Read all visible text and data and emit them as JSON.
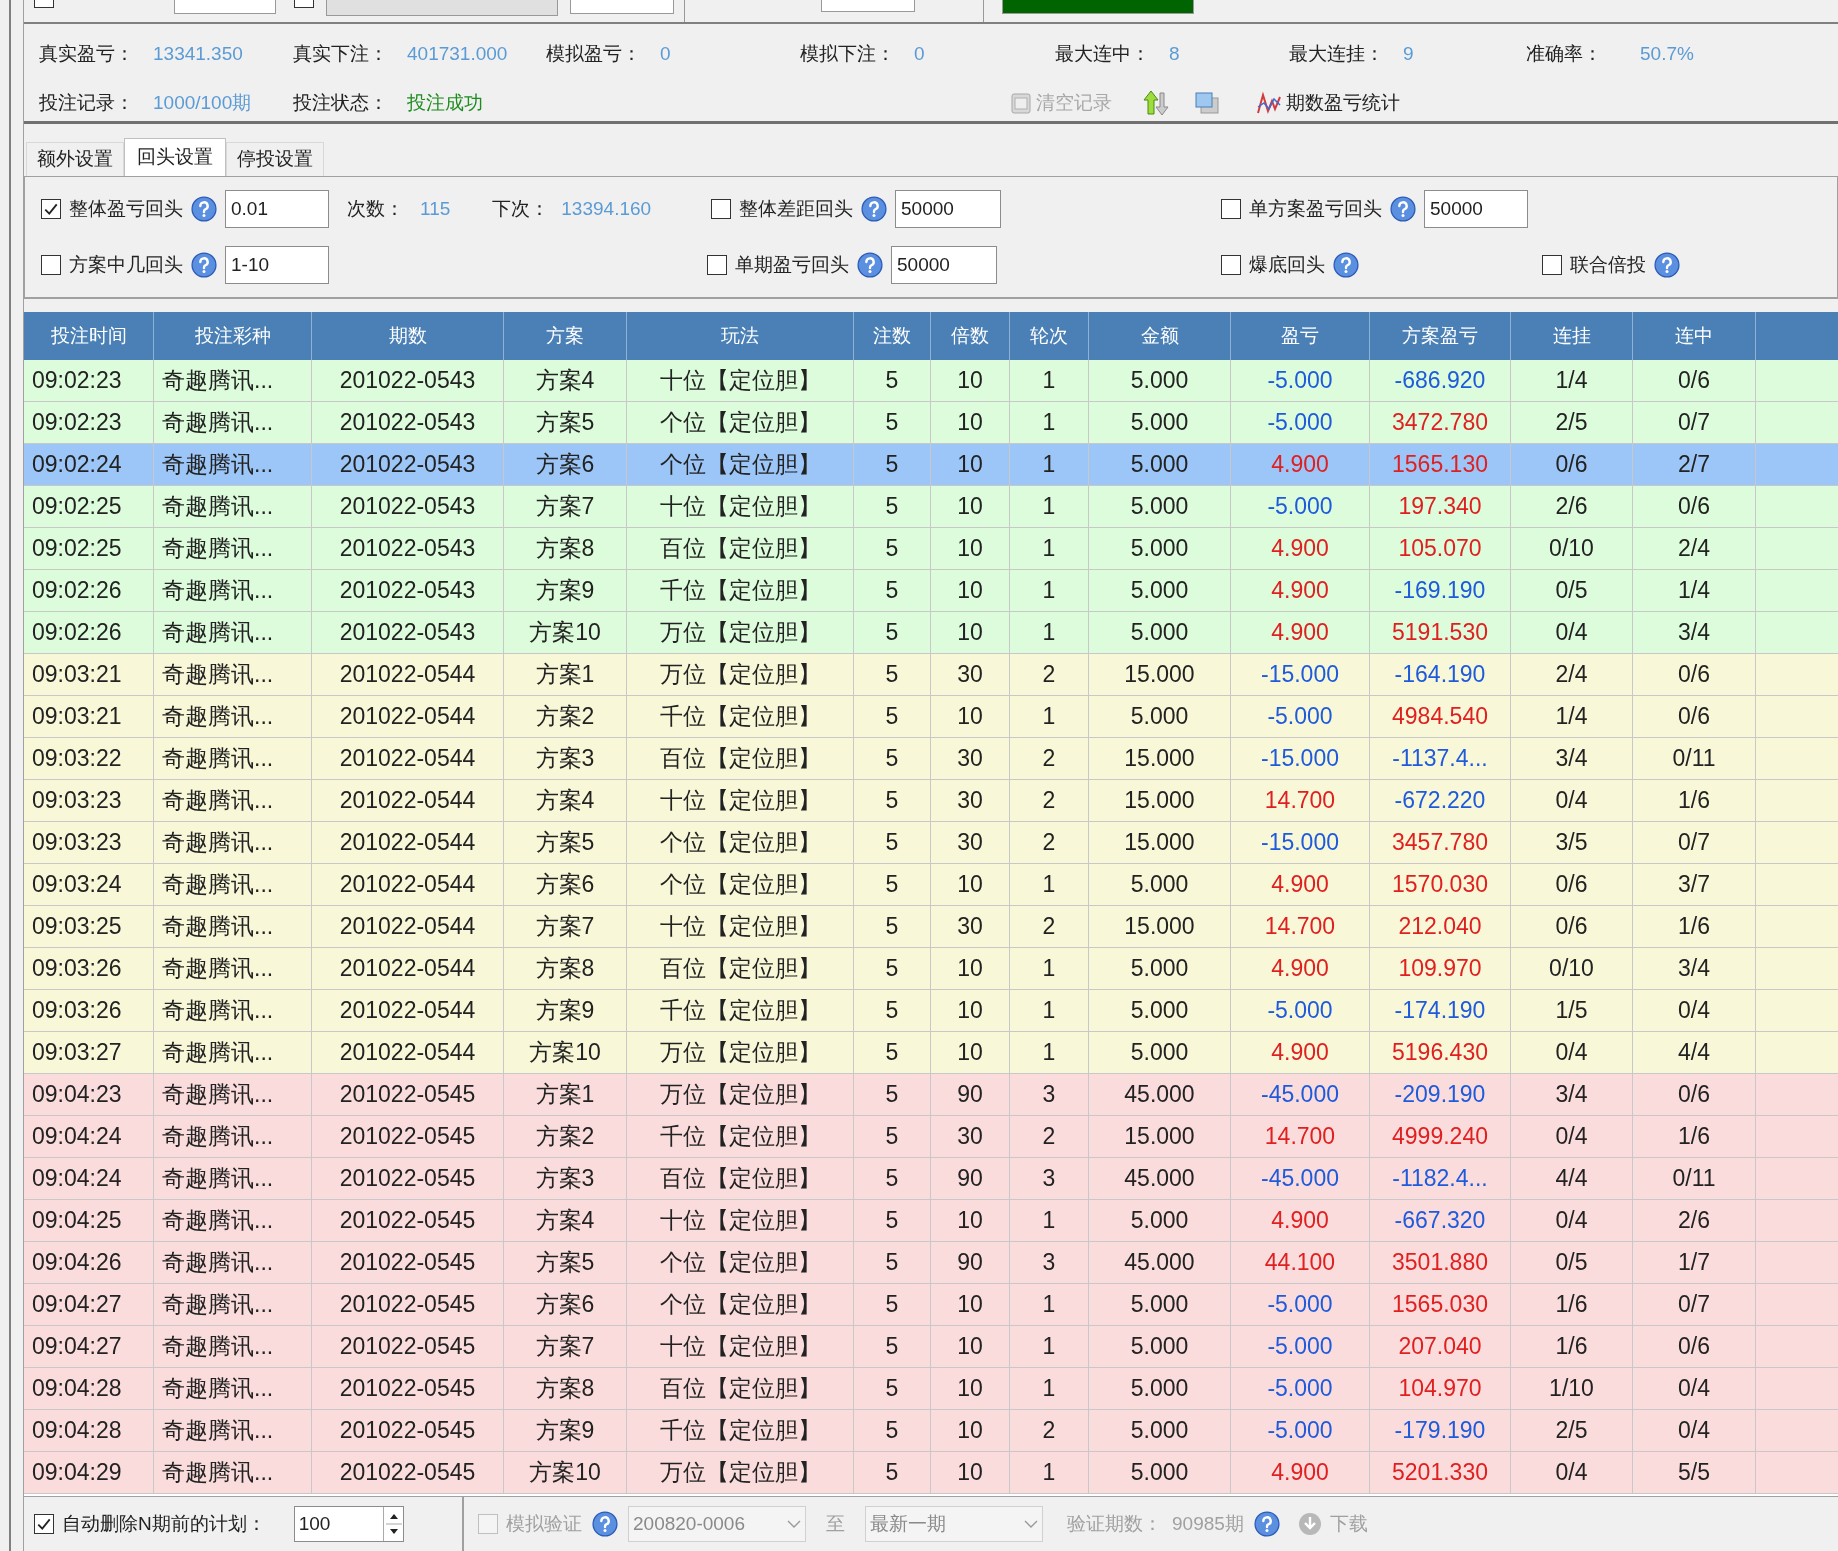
{
  "top": {
    "checkboxes": [
      {
        "checked": false
      },
      {
        "checked": false
      }
    ],
    "progress": {
      "level": 1
    }
  },
  "stats": [
    {
      "label": "真实盈亏：",
      "value": "13341.350"
    },
    {
      "label": "真实下注：",
      "value": "401731.000"
    },
    {
      "label": "模拟盈亏：",
      "value": "0"
    },
    {
      "label": "模拟下注：",
      "value": "0"
    },
    {
      "label": "最大连中：",
      "value": "8"
    },
    {
      "label": "最大连挂：",
      "value": "9"
    },
    {
      "label": "准确率：",
      "value": "50.7%"
    }
  ],
  "record": {
    "label": "投注记录：",
    "value": "1000/100期"
  },
  "status": {
    "label": "投注状态：",
    "value": "投注成功"
  },
  "toolbar": [
    {
      "kind": "clear",
      "label": "清空记录",
      "disabled": true
    },
    {
      "kind": "sort"
    },
    {
      "kind": "window"
    },
    {
      "kind": "stats",
      "label": "期数盈亏统计",
      "disabled": false
    }
  ],
  "tabs": [
    {
      "label": "额外设置",
      "selected": false
    },
    {
      "label": "回头设置",
      "selected": true
    },
    {
      "label": "停投设置",
      "selected": false
    }
  ],
  "settings": {
    "overall": {
      "label": "整体盈亏回头",
      "checked": true,
      "value": "0.01"
    },
    "count": {
      "label": "次数：",
      "value": "115"
    },
    "next": {
      "label": "下次：",
      "value": "13394.160"
    },
    "gap": {
      "label": "整体差距回头",
      "checked": false,
      "value": "50000"
    },
    "single_plan": {
      "label": "单方案盈亏回头",
      "checked": false,
      "value": "50000"
    },
    "plan_hit": {
      "label": "方案中几回头",
      "checked": false,
      "value": "1-10"
    },
    "single_period": {
      "label": "单期盈亏回头",
      "checked": false,
      "value": "50000"
    },
    "bottom_out": {
      "label": "爆底回头",
      "checked": false
    },
    "joint": {
      "label": "联合倍投",
      "checked": false
    }
  },
  "table": {
    "columns": [
      "投注时间",
      "投注彩种",
      "期数",
      "方案",
      "玩法",
      "注数",
      "倍数",
      "轮次",
      "金额",
      "盈亏",
      "方案盈亏",
      "连挂",
      "连中"
    ],
    "rows": [
      {
        "cells": [
          "09:02:23",
          "奇趣腾讯...",
          "201022-0543",
          "方案4",
          "十位【定位胆】",
          "5",
          "10",
          "1",
          "5.000",
          "-5.000",
          "-686.920",
          "1/4",
          "0/6"
        ],
        "color": "#dcfcdc",
        "selected": false,
        "loss": true,
        "plan_loss": true
      },
      {
        "cells": [
          "09:02:23",
          "奇趣腾讯...",
          "201022-0543",
          "方案5",
          "个位【定位胆】",
          "5",
          "10",
          "1",
          "5.000",
          "-5.000",
          "3472.780",
          "2/5",
          "0/7"
        ],
        "color": "#dcfcdc",
        "selected": false,
        "loss": true,
        "plan_loss": false
      },
      {
        "cells": [
          "09:02:24",
          "奇趣腾讯...",
          "201022-0543",
          "方案6",
          "个位【定位胆】",
          "5",
          "10",
          "1",
          "5.000",
          "4.900",
          "1565.130",
          "0/6",
          "2/7"
        ],
        "selected": true,
        "loss": false,
        "plan_loss": false
      },
      {
        "cells": [
          "09:02:25",
          "奇趣腾讯...",
          "201022-0543",
          "方案7",
          "十位【定位胆】",
          "5",
          "10",
          "1",
          "5.000",
          "-5.000",
          "197.340",
          "2/6",
          "0/6"
        ],
        "color": "#dcfcdc",
        "selected": false,
        "loss": true,
        "plan_loss": false
      },
      {
        "cells": [
          "09:02:25",
          "奇趣腾讯...",
          "201022-0543",
          "方案8",
          "百位【定位胆】",
          "5",
          "10",
          "1",
          "5.000",
          "4.900",
          "105.070",
          "0/10",
          "2/4"
        ],
        "color": "#dcfcdc",
        "selected": false,
        "loss": false,
        "plan_loss": false
      },
      {
        "cells": [
          "09:02:26",
          "奇趣腾讯...",
          "201022-0543",
          "方案9",
          "千位【定位胆】",
          "5",
          "10",
          "1",
          "5.000",
          "4.900",
          "-169.190",
          "0/5",
          "1/4"
        ],
        "color": "#dcfcdc",
        "selected": false,
        "loss": false,
        "plan_loss": true
      },
      {
        "cells": [
          "09:02:26",
          "奇趣腾讯...",
          "201022-0543",
          "方案10",
          "万位【定位胆】",
          "5",
          "10",
          "1",
          "5.000",
          "4.900",
          "5191.530",
          "0/4",
          "3/4"
        ],
        "color": "#dcfcdc",
        "selected": false,
        "loss": false,
        "plan_loss": false
      },
      {
        "cells": [
          "09:03:21",
          "奇趣腾讯...",
          "201022-0544",
          "方案1",
          "万位【定位胆】",
          "5",
          "30",
          "2",
          "15.000",
          "-15.000",
          "-164.190",
          "2/4",
          "0/6"
        ],
        "color": "#f8f8d8",
        "selected": false,
        "loss": true,
        "plan_loss": true
      },
      {
        "cells": [
          "09:03:21",
          "奇趣腾讯...",
          "201022-0544",
          "方案2",
          "千位【定位胆】",
          "5",
          "10",
          "1",
          "5.000",
          "-5.000",
          "4984.540",
          "1/4",
          "0/6"
        ],
        "color": "#f8f8d8",
        "selected": false,
        "loss": true,
        "plan_loss": false
      },
      {
        "cells": [
          "09:03:22",
          "奇趣腾讯...",
          "201022-0544",
          "方案3",
          "百位【定位胆】",
          "5",
          "30",
          "2",
          "15.000",
          "-15.000",
          "-1137.4...",
          "3/4",
          "0/11"
        ],
        "color": "#f8f8d8",
        "selected": false,
        "loss": true,
        "plan_loss": true
      },
      {
        "cells": [
          "09:03:23",
          "奇趣腾讯...",
          "201022-0544",
          "方案4",
          "十位【定位胆】",
          "5",
          "30",
          "2",
          "15.000",
          "14.700",
          "-672.220",
          "0/4",
          "1/6"
        ],
        "color": "#f8f8d8",
        "selected": false,
        "loss": false,
        "plan_loss": true
      },
      {
        "cells": [
          "09:03:23",
          "奇趣腾讯...",
          "201022-0544",
          "方案5",
          "个位【定位胆】",
          "5",
          "30",
          "2",
          "15.000",
          "-15.000",
          "3457.780",
          "3/5",
          "0/7"
        ],
        "color": "#f8f8d8",
        "selected": false,
        "loss": true,
        "plan_loss": false
      },
      {
        "cells": [
          "09:03:24",
          "奇趣腾讯...",
          "201022-0544",
          "方案6",
          "个位【定位胆】",
          "5",
          "10",
          "1",
          "5.000",
          "4.900",
          "1570.030",
          "0/6",
          "3/7"
        ],
        "color": "#f8f8d8",
        "selected": false,
        "loss": false,
        "plan_loss": false
      },
      {
        "cells": [
          "09:03:25",
          "奇趣腾讯...",
          "201022-0544",
          "方案7",
          "十位【定位胆】",
          "5",
          "30",
          "2",
          "15.000",
          "14.700",
          "212.040",
          "0/6",
          "1/6"
        ],
        "color": "#f8f8d8",
        "selected": false,
        "loss": false,
        "plan_loss": false
      },
      {
        "cells": [
          "09:03:26",
          "奇趣腾讯...",
          "201022-0544",
          "方案8",
          "百位【定位胆】",
          "5",
          "10",
          "1",
          "5.000",
          "4.900",
          "109.970",
          "0/10",
          "3/4"
        ],
        "color": "#f8f8d8",
        "selected": false,
        "loss": false,
        "plan_loss": false
      },
      {
        "cells": [
          "09:03:26",
          "奇趣腾讯...",
          "201022-0544",
          "方案9",
          "千位【定位胆】",
          "5",
          "10",
          "1",
          "5.000",
          "-5.000",
          "-174.190",
          "1/5",
          "0/4"
        ],
        "color": "#f8f8d8",
        "selected": false,
        "loss": true,
        "plan_loss": true
      },
      {
        "cells": [
          "09:03:27",
          "奇趣腾讯...",
          "201022-0544",
          "方案10",
          "万位【定位胆】",
          "5",
          "10",
          "1",
          "5.000",
          "4.900",
          "5196.430",
          "0/4",
          "4/4"
        ],
        "color": "#f8f8d8",
        "selected": false,
        "loss": false,
        "plan_loss": false
      },
      {
        "cells": [
          "09:04:23",
          "奇趣腾讯...",
          "201022-0545",
          "方案1",
          "万位【定位胆】",
          "5",
          "90",
          "3",
          "45.000",
          "-45.000",
          "-209.190",
          "3/4",
          "0/6"
        ],
        "color": "#fbdcdc",
        "selected": false,
        "loss": true,
        "plan_loss": true
      },
      {
        "cells": [
          "09:04:24",
          "奇趣腾讯...",
          "201022-0545",
          "方案2",
          "千位【定位胆】",
          "5",
          "30",
          "2",
          "15.000",
          "14.700",
          "4999.240",
          "0/4",
          "1/6"
        ],
        "color": "#fbdcdc",
        "selected": false,
        "loss": false,
        "plan_loss": false
      },
      {
        "cells": [
          "09:04:24",
          "奇趣腾讯...",
          "201022-0545",
          "方案3",
          "百位【定位胆】",
          "5",
          "90",
          "3",
          "45.000",
          "-45.000",
          "-1182.4...",
          "4/4",
          "0/11"
        ],
        "color": "#fbdcdc",
        "selected": false,
        "loss": true,
        "plan_loss": true
      },
      {
        "cells": [
          "09:04:25",
          "奇趣腾讯...",
          "201022-0545",
          "方案4",
          "十位【定位胆】",
          "5",
          "10",
          "1",
          "5.000",
          "4.900",
          "-667.320",
          "0/4",
          "2/6"
        ],
        "color": "#fbdcdc",
        "selected": false,
        "loss": false,
        "plan_loss": true
      },
      {
        "cells": [
          "09:04:26",
          "奇趣腾讯...",
          "201022-0545",
          "方案5",
          "个位【定位胆】",
          "5",
          "90",
          "3",
          "45.000",
          "44.100",
          "3501.880",
          "0/5",
          "1/7"
        ],
        "color": "#fbdcdc",
        "selected": false,
        "loss": false,
        "plan_loss": false
      },
      {
        "cells": [
          "09:04:27",
          "奇趣腾讯...",
          "201022-0545",
          "方案6",
          "个位【定位胆】",
          "5",
          "10",
          "1",
          "5.000",
          "-5.000",
          "1565.030",
          "1/6",
          "0/7"
        ],
        "color": "#fbdcdc",
        "selected": false,
        "loss": true,
        "plan_loss": false
      },
      {
        "cells": [
          "09:04:27",
          "奇趣腾讯...",
          "201022-0545",
          "方案7",
          "十位【定位胆】",
          "5",
          "10",
          "1",
          "5.000",
          "-5.000",
          "207.040",
          "1/6",
          "0/6"
        ],
        "color": "#fbdcdc",
        "selected": false,
        "loss": true,
        "plan_loss": false
      },
      {
        "cells": [
          "09:04:28",
          "奇趣腾讯...",
          "201022-0545",
          "方案8",
          "百位【定位胆】",
          "5",
          "10",
          "1",
          "5.000",
          "-5.000",
          "104.970",
          "1/10",
          "0/4"
        ],
        "color": "#fbdcdc",
        "selected": false,
        "loss": true,
        "plan_loss": false
      },
      {
        "cells": [
          "09:04:28",
          "奇趣腾讯...",
          "201022-0545",
          "方案9",
          "千位【定位胆】",
          "5",
          "10",
          "2",
          "5.000",
          "-5.000",
          "-179.190",
          "2/5",
          "0/4"
        ],
        "color": "#fbdcdc",
        "selected": false,
        "loss": true,
        "plan_loss": true
      },
      {
        "cells": [
          "09:04:29",
          "奇趣腾讯...",
          "201022-0545",
          "方案10",
          "万位【定位胆】",
          "5",
          "10",
          "1",
          "5.000",
          "4.900",
          "5201.330",
          "0/4",
          "5/5"
        ],
        "color": "#fbdcdc",
        "selected": false,
        "loss": false,
        "plan_loss": false
      }
    ]
  },
  "bottom": {
    "auto_delete": {
      "label": "自动删除N期前的计划：",
      "checked": true,
      "value": "100"
    },
    "simulate": {
      "label": "模拟验证",
      "checked": false,
      "disabled": true
    },
    "from": "200820-0006",
    "to_label": "至",
    "to": "最新一期",
    "periods": {
      "label": "验证期数：",
      "value": "90985期"
    },
    "download": {
      "label": "下载",
      "disabled": true
    }
  }
}
